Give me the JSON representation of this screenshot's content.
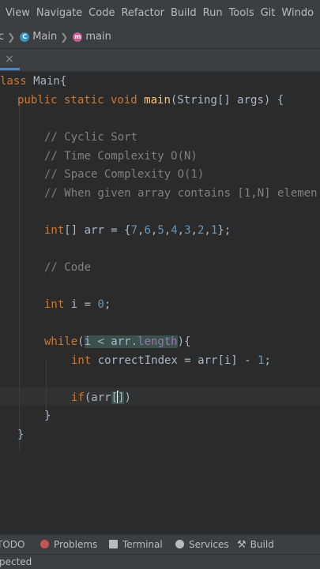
{
  "menu": {
    "items": [
      "View",
      "Navigate",
      "Code",
      "Refactor",
      "Build",
      "Run",
      "Tools",
      "Git",
      "Windo"
    ]
  },
  "breadcrumb": {
    "prefix": "c",
    "class_name": "Main",
    "method_name": "main"
  },
  "tab": {
    "close_glyph": "×"
  },
  "editor": {
    "class_decl": {
      "keyword": "lass",
      "name": " Main{"
    },
    "main_decl": {
      "keywords": "public static void ",
      "name": "main",
      "params": "(String[] args) {"
    },
    "comments": [
      "// Cyclic Sort",
      "// Time Complexity O(N)",
      "// Space Complexity O(1)",
      "// When given array contains [1,N] elemen"
    ],
    "arr_decl": {
      "keyword": "int",
      "mid": "[] arr = {",
      "values": [
        "7",
        "6",
        "5",
        "4",
        "3",
        "2",
        "1"
      ],
      "end": "};"
    },
    "code_comment": "// Code",
    "i_decl": {
      "keyword": "int",
      "mid": " i = ",
      "value": "0",
      "end": ";"
    },
    "while_line": {
      "keyword": "while",
      "open": "(",
      "cond": "i < arr.",
      "field": "length",
      "close": "){"
    },
    "index_line": {
      "keyword": "int",
      "var": " correctIndex = arr[i] - ",
      "value": "1",
      "end": ";"
    },
    "if_line": {
      "keyword": "if",
      "pre": "(arr",
      "bracket_open": "[",
      "bracket_close": "]",
      "end": ")"
    },
    "close_inner": "}",
    "close_outer": "}"
  },
  "toolwindows": {
    "todo": "TODO",
    "problems": "Problems",
    "terminal": "Terminal",
    "services": "Services",
    "build": "Build"
  },
  "status": {
    "message": "pected"
  }
}
